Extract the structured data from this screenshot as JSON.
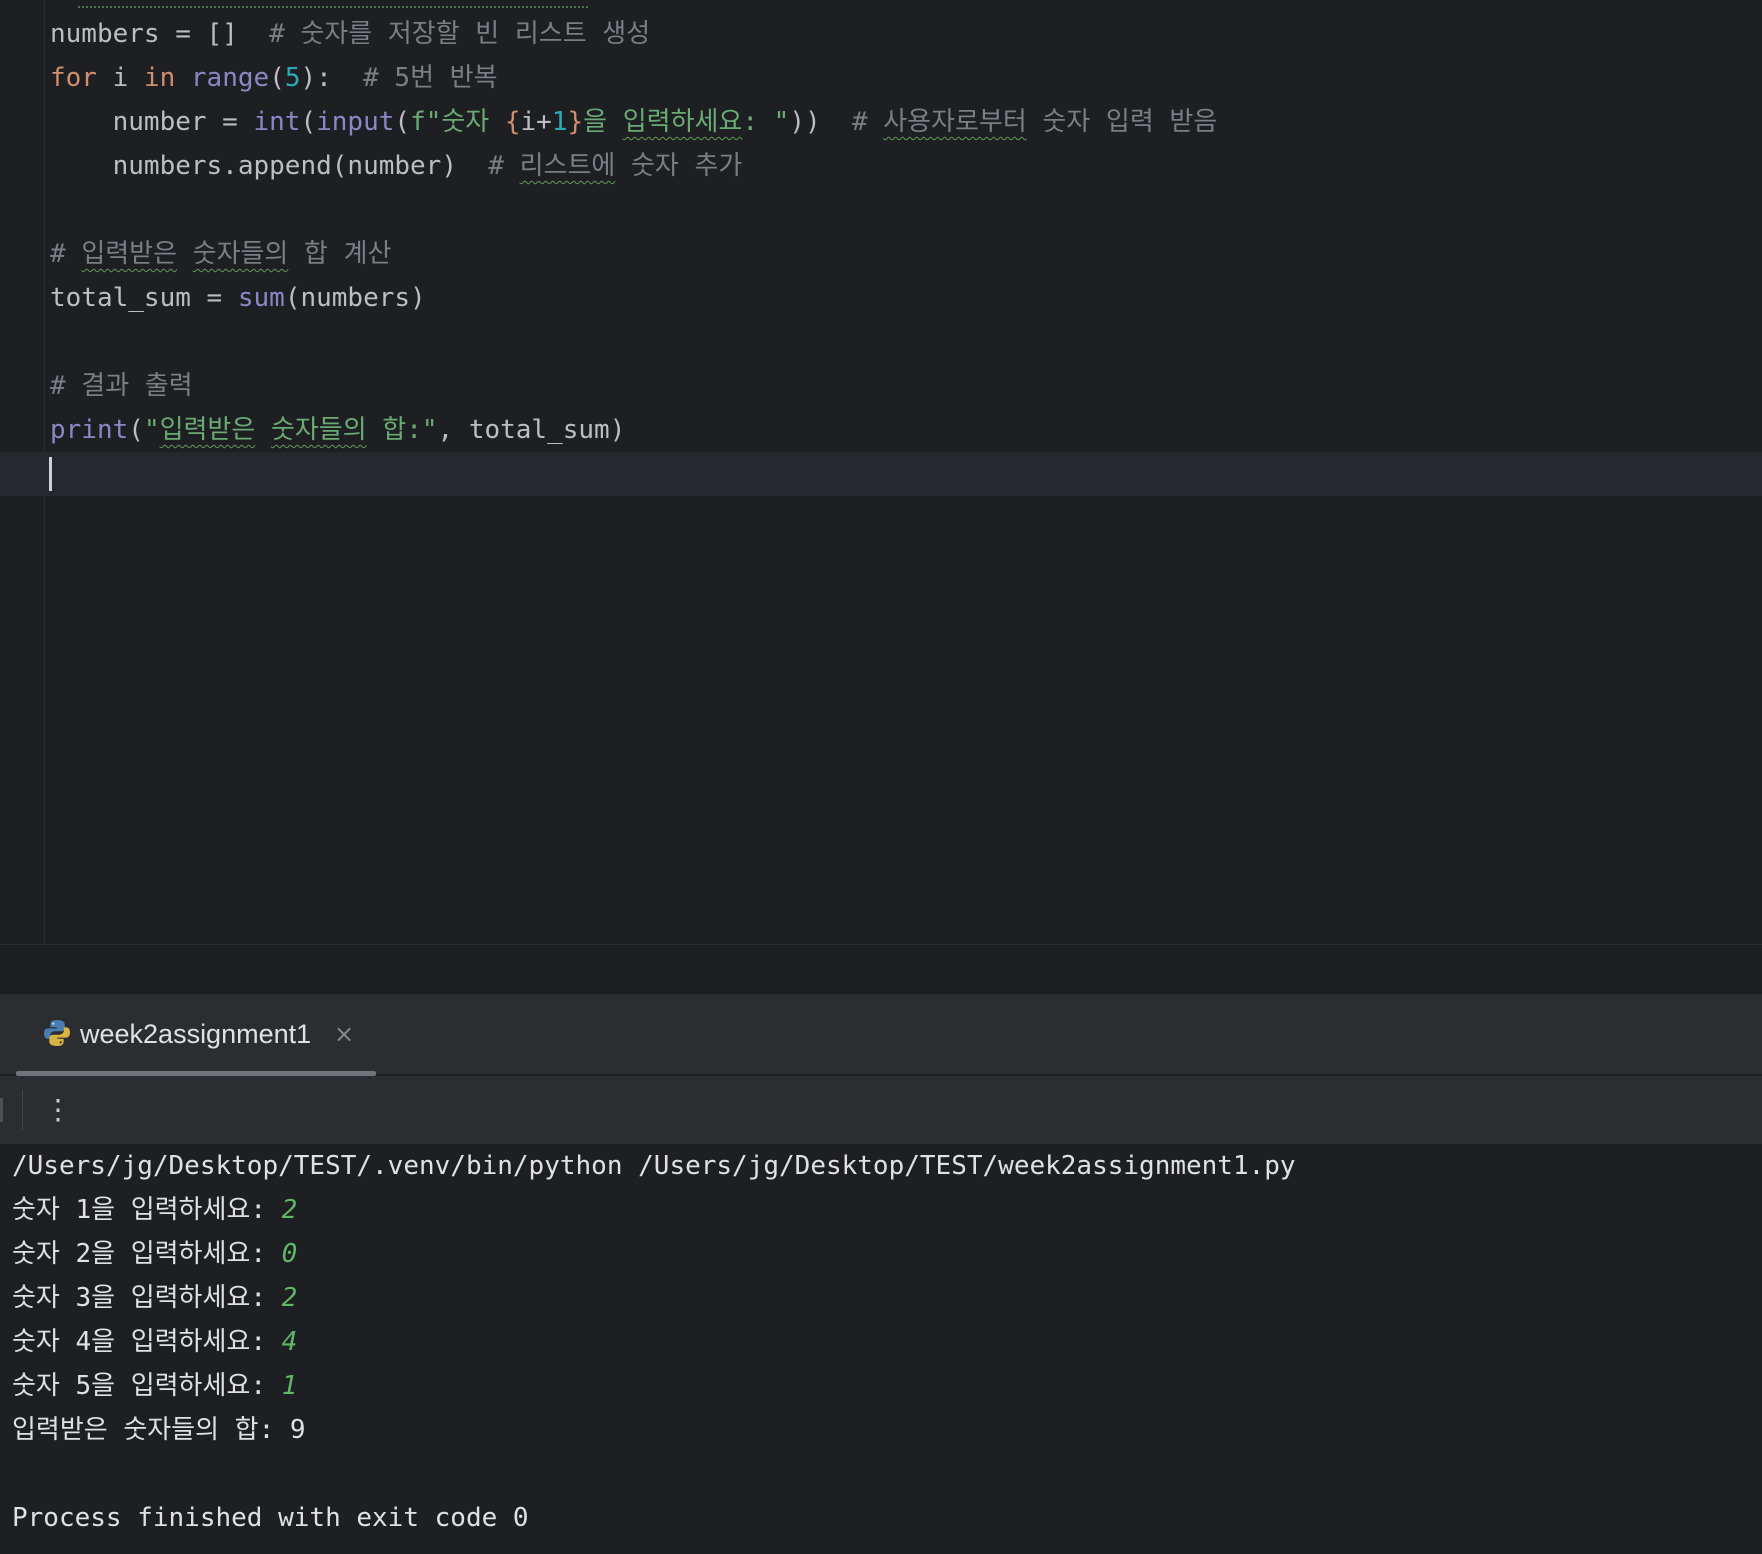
{
  "editor": {
    "lines": [
      {
        "t": "numbers = []  ",
        "c": "# 숫자를 저장할 빈 리스트 생성"
      },
      {
        "kw1": "for",
        "t1": " i ",
        "kw2": "in",
        "t2": " ",
        "fn": "range",
        "p1": "(",
        "num": "5",
        "p2": "):  ",
        "c": "# 5번 반복"
      },
      {
        "pre": "    number = ",
        "fn1": "int",
        "p1": "(",
        "fn2": "input",
        "p2": "(",
        "s1": "f\"숫자 ",
        "b1": "{",
        "expr": "i+",
        "n": "1",
        "b2": "}",
        "s2": "을 ",
        "s3": "입력하세요",
        "s4": ": \"",
        "p3": "))  ",
        "c1": "# ",
        "c2": "사용자로부터",
        "c3": " 숫자 입력 받음"
      },
      {
        "pre": "    numbers.append(number)  ",
        "c1": "# ",
        "c2": "리스트에",
        "c3": " 숫자 추가"
      },
      {
        "c1": "# ",
        "c2": "입력받은",
        "c3": " ",
        "c4": "숫자들의",
        "c5": " 합 계산"
      },
      {
        "pre": "total_sum = ",
        "fn": "sum",
        "post": "(numbers)"
      },
      {
        "c": "# 결과 출력"
      },
      {
        "fn": "print",
        "p1": "(",
        "s1": "\"",
        "s2": "입력받은",
        "s3": " ",
        "s4": "숫자들의",
        "s5": " 합:\"",
        "post": ", total_sum)"
      }
    ]
  },
  "run": {
    "tab_title": "week2assignment1",
    "close_glyph": "×",
    "more_glyph": "⋮"
  },
  "console": {
    "command": "/Users/jg/Desktop/TEST/.venv/bin/python /Users/jg/Desktop/TEST/week2assignment1.py",
    "prompts": [
      {
        "label": "숫자 1을 입력하세요: ",
        "value": "2"
      },
      {
        "label": "숫자 2을 입력하세요: ",
        "value": "0"
      },
      {
        "label": "숫자 3을 입력하세요: ",
        "value": "2"
      },
      {
        "label": "숫자 4을 입력하세요: ",
        "value": "4"
      },
      {
        "label": "숫자 5을 입력하세요: ",
        "value": "1"
      }
    ],
    "result": "입력받은 숫자들의 합: 9",
    "exit": "Process finished with exit code 0"
  },
  "colors": {
    "background": "#1e1f22",
    "keyword": "#cf8e6d",
    "builtin": "#8888c6",
    "number": "#2aacb8",
    "string": "#6aab73",
    "comment": "#7a7e85",
    "user_input": "#5fb865"
  }
}
